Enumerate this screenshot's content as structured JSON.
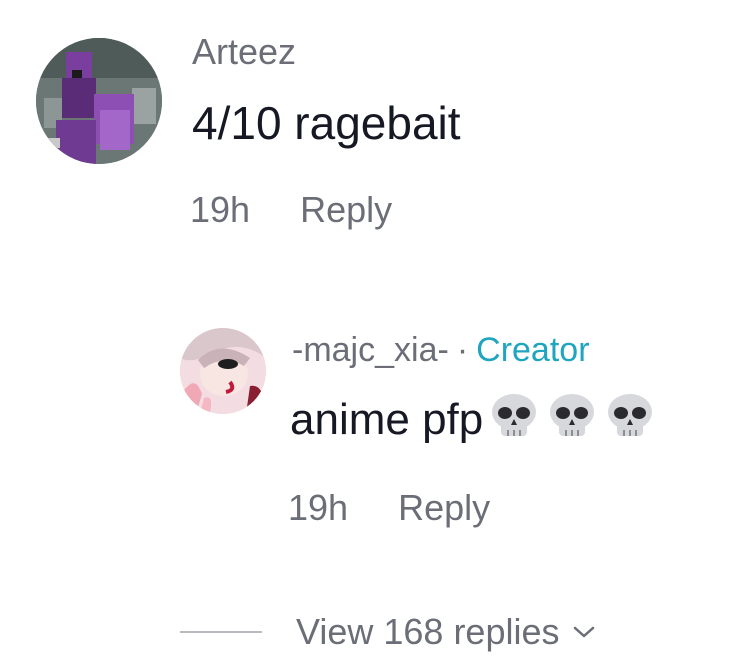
{
  "comments": [
    {
      "username": "Arteez",
      "text": "4/10 ragebait",
      "time": "19h",
      "reply_label": "Reply",
      "avatar_icon": "pixel-character-avatar"
    }
  ],
  "reply": {
    "username": "-majc_xia-",
    "separator": "·",
    "badge": "Creator",
    "badge_color": "#20a5bf",
    "text": "anime pfp",
    "emoji": [
      "💀",
      "💀",
      "💀"
    ],
    "time": "19h",
    "reply_label": "Reply",
    "avatar_icon": "anime-character-avatar"
  },
  "view_replies": {
    "label": "View 168 replies",
    "icon": "chevron-down-icon"
  }
}
